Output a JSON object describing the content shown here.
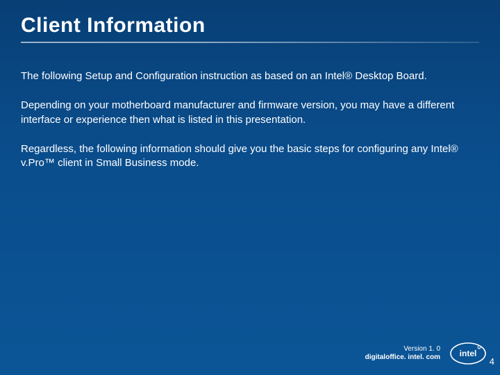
{
  "slide": {
    "title": "Client Information",
    "paragraphs": [
      "The following Setup and Configuration instruction as based on an Intel® Desktop Board.",
      "Depending on your motherboard manufacturer and firmware version, you may have a different interface or experience then what is listed in this presentation.",
      "Regardless, the following information should give you the basic steps for configuring any Intel® v.Pro™ client in Small Business mode."
    ]
  },
  "footer": {
    "version": "Version 1. 0",
    "url": "digitaloffice. intel. com"
  },
  "logo": {
    "name": "intel"
  },
  "page_number": "4"
}
